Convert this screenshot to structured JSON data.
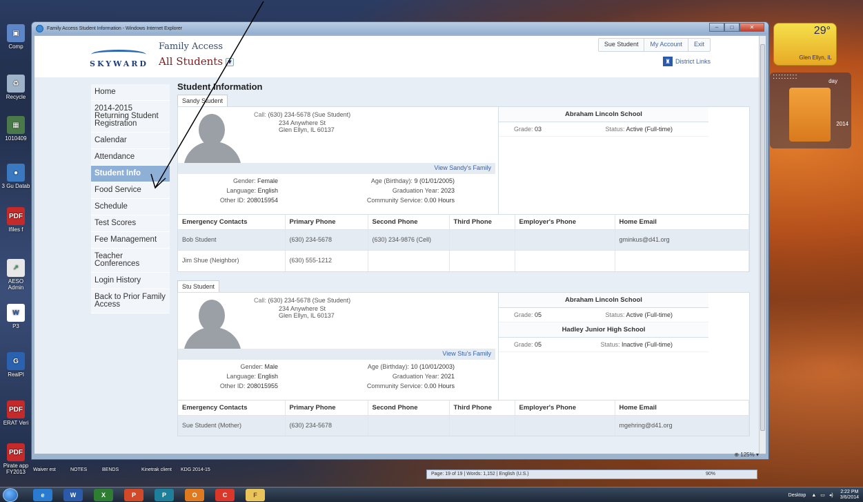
{
  "window": {
    "title": "Family Access Student Information - Windows Internet Explorer"
  },
  "header": {
    "app_name": "Family Access",
    "student_selector": "All Students",
    "logo_text": "SKYWARD",
    "top_links": [
      "Sue Student",
      "My Account",
      "Exit"
    ],
    "district_links": "District Links"
  },
  "nav": {
    "items": [
      {
        "label": "Home"
      },
      {
        "label": "2014-2015 Returning Student Registration"
      },
      {
        "label": "Calendar"
      },
      {
        "label": "Attendance"
      },
      {
        "label": "Student Info",
        "active": true
      },
      {
        "label": "Food Service"
      },
      {
        "label": "Schedule"
      },
      {
        "label": "Test Scores"
      },
      {
        "label": "Fee Management"
      },
      {
        "label": "Teacher Conferences"
      },
      {
        "label": "Login History"
      },
      {
        "label": "Back to Prior Family Access"
      }
    ]
  },
  "main": {
    "title": "Student Information",
    "labels": {
      "call": "Call:",
      "gender": "Gender:",
      "language": "Language:",
      "other_id": "Other ID:",
      "age": "Age (Birthday):",
      "grad_year": "Graduation Year:",
      "community": "Community Service:",
      "grade": "Grade:",
      "status": "Status:"
    },
    "table_headers": [
      "Emergency Contacts",
      "Primary Phone",
      "Second Phone",
      "Third Phone",
      "Employer's Phone",
      "Home Email"
    ],
    "students": [
      {
        "tab": "Sandy Student",
        "call": "(630) 234-5678 (Sue Student)",
        "address1": "234 Anywhere St",
        "address2": "Glen Ellyn, IL 60137",
        "view_family": "View Sandy's Family",
        "gender": "Female",
        "language": "English",
        "other_id": "208015954",
        "age": "9 (01/01/2005)",
        "grad_year": "2023",
        "community": "0.00 Hours",
        "schools": [
          {
            "name": "Abraham Lincoln School",
            "grade": "03",
            "status": "Active (Full-time)"
          }
        ],
        "contacts": [
          [
            "Bob Student",
            "(630) 234-5678",
            "(630) 234-9876 (Cell)",
            "",
            "",
            "gminkus@d41.org"
          ],
          [
            "Jim Shue (Neighbor)",
            "(630) 555-1212",
            "",
            "",
            "",
            ""
          ]
        ]
      },
      {
        "tab": "Stu Student",
        "call": "(630) 234-5678 (Sue Student)",
        "address1": "234 Anywhere St",
        "address2": "Glen Ellyn, IL 60137",
        "view_family": "View Stu's Family",
        "gender": "Male",
        "language": "English",
        "other_id": "208015955",
        "age": "10 (10/01/2003)",
        "grad_year": "2021",
        "community": "0.00 Hours",
        "schools": [
          {
            "name": "Abraham Lincoln School",
            "grade": "05",
            "status": "Active (Full-time)"
          },
          {
            "name": "Hadley Junior High School",
            "grade": "05",
            "status": "Inactive (Full-time)"
          }
        ],
        "contacts": [
          [
            "Sue Student (Mother)",
            "(630) 234-5678",
            "",
            "",
            "",
            "mgehring@d41.org"
          ]
        ]
      }
    ]
  },
  "browser": {
    "zoom": "125%"
  },
  "desktop": {
    "weather_temp": "29°",
    "weather_city": "Glen Ellyn, IL",
    "calendar_year": "2014",
    "calendar_day": "day",
    "left_icons": [
      "Comp",
      "Recycle",
      "1010409",
      "3 Gu Datab",
      "Ifiles f",
      "AESO Admin",
      "P3",
      "RealPl",
      "ERAT Veri",
      "Pirate app FY2013"
    ],
    "strip_labels": [
      "Waiver est",
      "NOTES",
      "BENDS",
      "Kinetrak client",
      "KDG 2014-15"
    ],
    "word_status": "Page: 19 of 19 | Words: 1,152 | English (U.S.)",
    "word_zoom": "90%"
  },
  "taskbar": {
    "apps": [
      "e",
      "W",
      "X",
      "P",
      "P",
      "O",
      "C",
      "F"
    ],
    "tray_label": "Desktop",
    "time": "2:22 PM",
    "date": "3/6/2014"
  },
  "colors": {
    "nav_active": "#8fb0d6",
    "brand": "#1e3f7a",
    "accent": "#3a62a8",
    "school_name_bar": "#fafbfd"
  }
}
